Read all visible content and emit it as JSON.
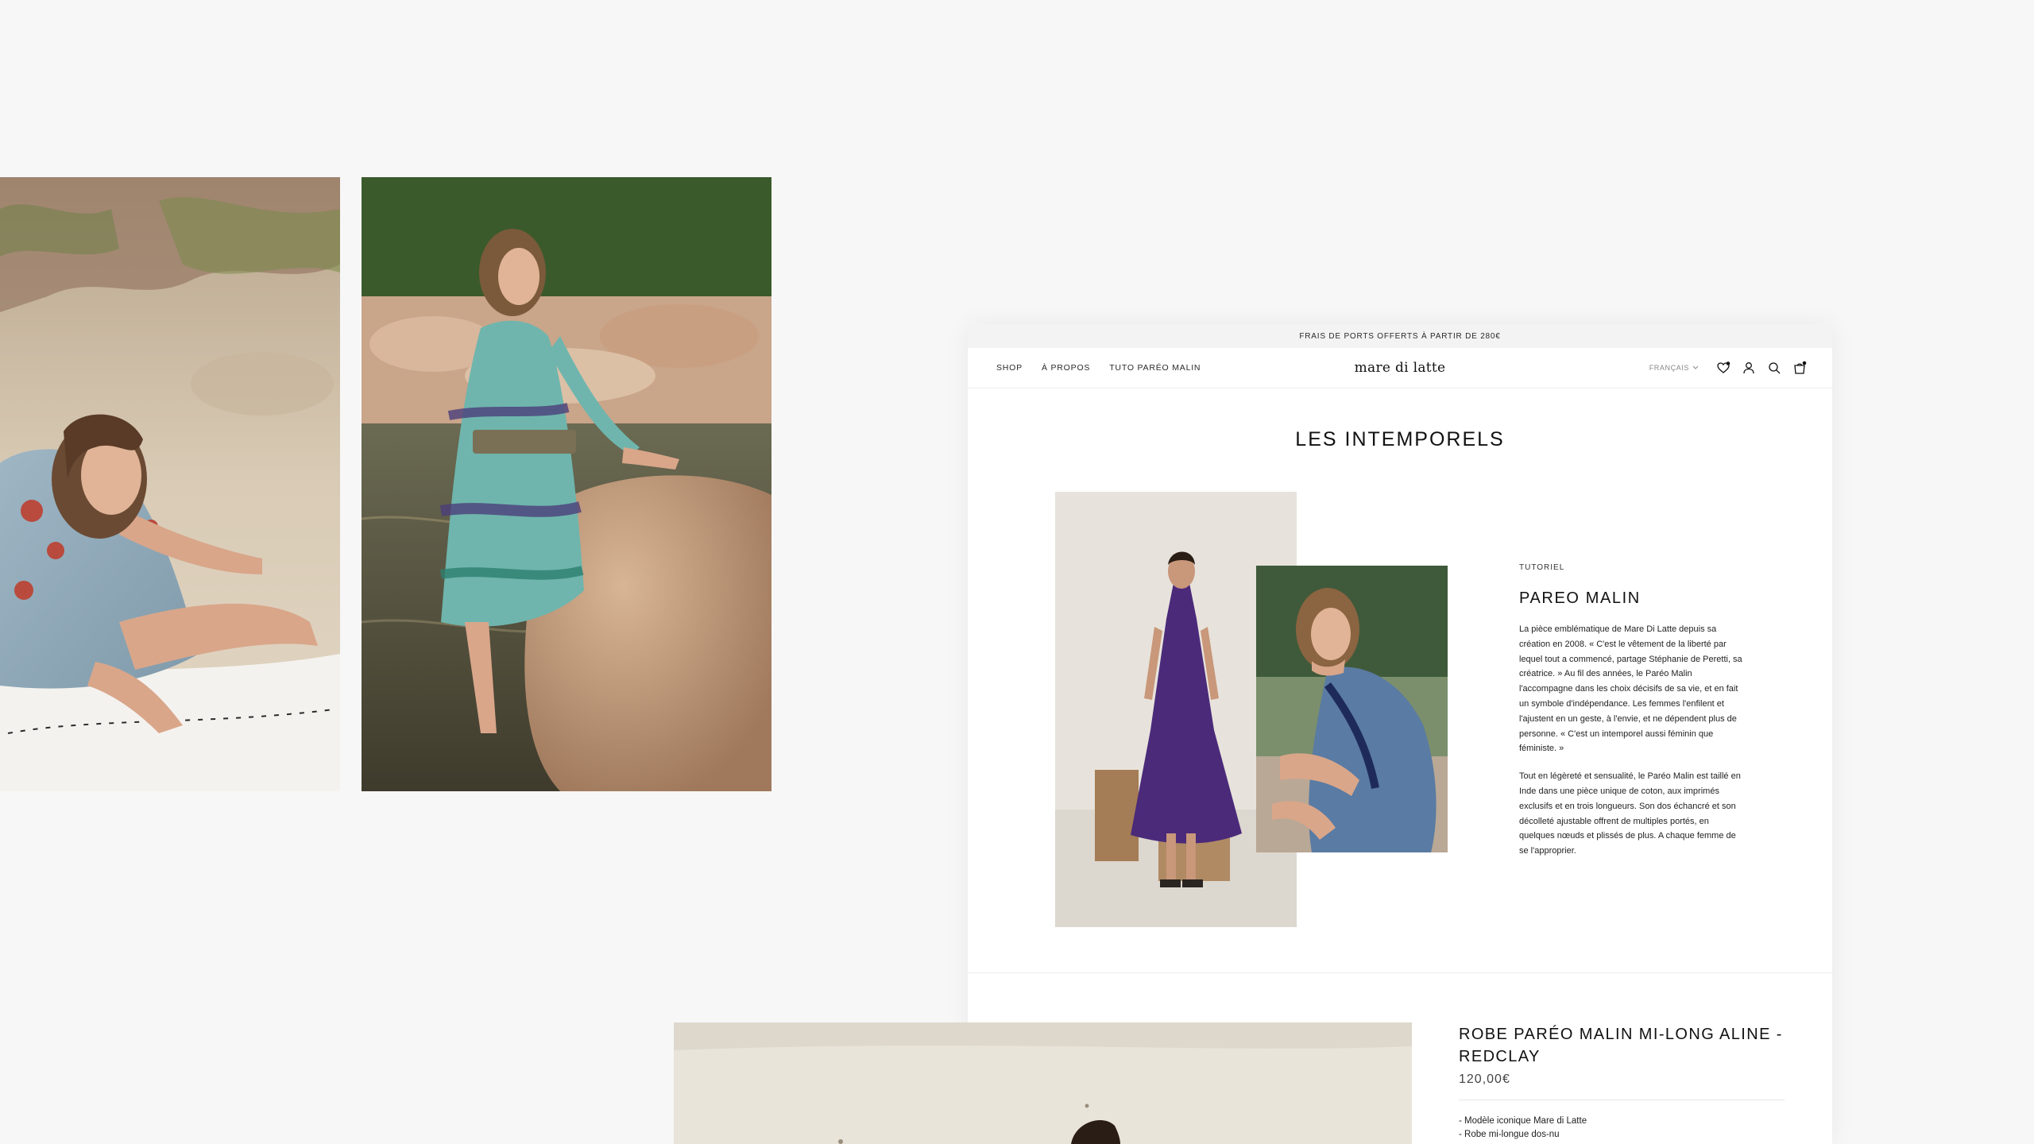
{
  "announcement": "FRAIS DE PORTS OFFERTS À PARTIR DE 280€",
  "nav": {
    "links": [
      "SHOP",
      "À PROPOS",
      "TUTO PARÉO MALIN"
    ],
    "brand": "mare di latte",
    "language": "FRANÇAIS",
    "icons": [
      "wishlist-icon",
      "account-icon",
      "search-icon",
      "cart-icon"
    ]
  },
  "section": {
    "title": "LES INTEMPORELS"
  },
  "article": {
    "kicker": "TUTORIEL",
    "title": "PAREO MALIN",
    "paragraphs": [
      "La pièce emblématique de Mare Di Latte depuis sa création en 2008. « C'est le vêtement de la liberté par lequel tout a commencé, partage Stéphanie de Peretti, sa créatrice. » Au fil des années, le Paréo Malin l'accompagne dans les choix décisifs de sa vie, et en fait un symbole d'indépendance. Les femmes l'enfilent et l'ajustent en un geste, à l'envie, et ne dépendent plus de personne. « C'est un intemporel aussi féminin que féministe. »",
      "Tout en légèreté et sensualité, le Paréo Malin est taillé en Inde dans une pièce unique de coton, aux imprimés exclusifs et en trois longueurs. Son dos échancré et son décolleté ajustable offrent de multiples portés, en quelques nœuds et plissés de plus. A chaque femme de se l'approprier."
    ]
  },
  "product": {
    "name": "ROBE PARÉO MALIN MI-LONG ALINE - REDCLAY",
    "price": "120,00€",
    "details": [
      "- Modèle iconique Mare di Latte",
      "- Robe mi-longue dos-nu"
    ]
  },
  "colors": {
    "background": "#f7f7f7",
    "announcement_bar": "#f3f3f3",
    "text": "#1a1a1a",
    "purple_dress": "#4b2a7a",
    "denim_dress": "#5a7ba3",
    "teal_dress": "#6fb5ad"
  }
}
